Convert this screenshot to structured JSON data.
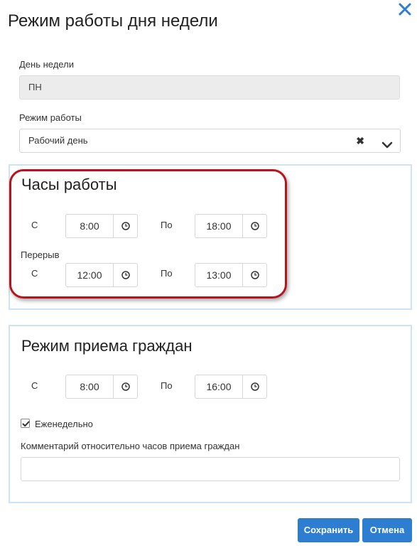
{
  "dialog": {
    "title": "Режим работы дня недели",
    "close_icon": "close-icon"
  },
  "day_of_week": {
    "label": "День недели",
    "value": "ПН"
  },
  "work_mode": {
    "label": "Режим работы",
    "value": "Рабочий день",
    "clear_glyph": "✖"
  },
  "work_hours": {
    "title": "Часы работы",
    "from_label": "С",
    "to_label": "По",
    "from": "8:00",
    "to": "18:00",
    "break_label": "Перерыв",
    "break_from_label": "С",
    "break_to_label": "По",
    "break_from": "12:00",
    "break_to": "13:00"
  },
  "reception": {
    "title": "Режим приема граждан",
    "from_label": "С",
    "to_label": "По",
    "from": "8:00",
    "to": "16:00",
    "weekly_label": "Еженедельно",
    "weekly_checked": true,
    "comment_label": "Комментарий относительно часов приема граждан",
    "comment_value": ""
  },
  "buttons": {
    "save": "Сохранить",
    "cancel": "Отмена"
  },
  "colors": {
    "accent": "#2d7ed1",
    "panel_border": "#cfe3f2",
    "highlight": "#b5161e"
  }
}
